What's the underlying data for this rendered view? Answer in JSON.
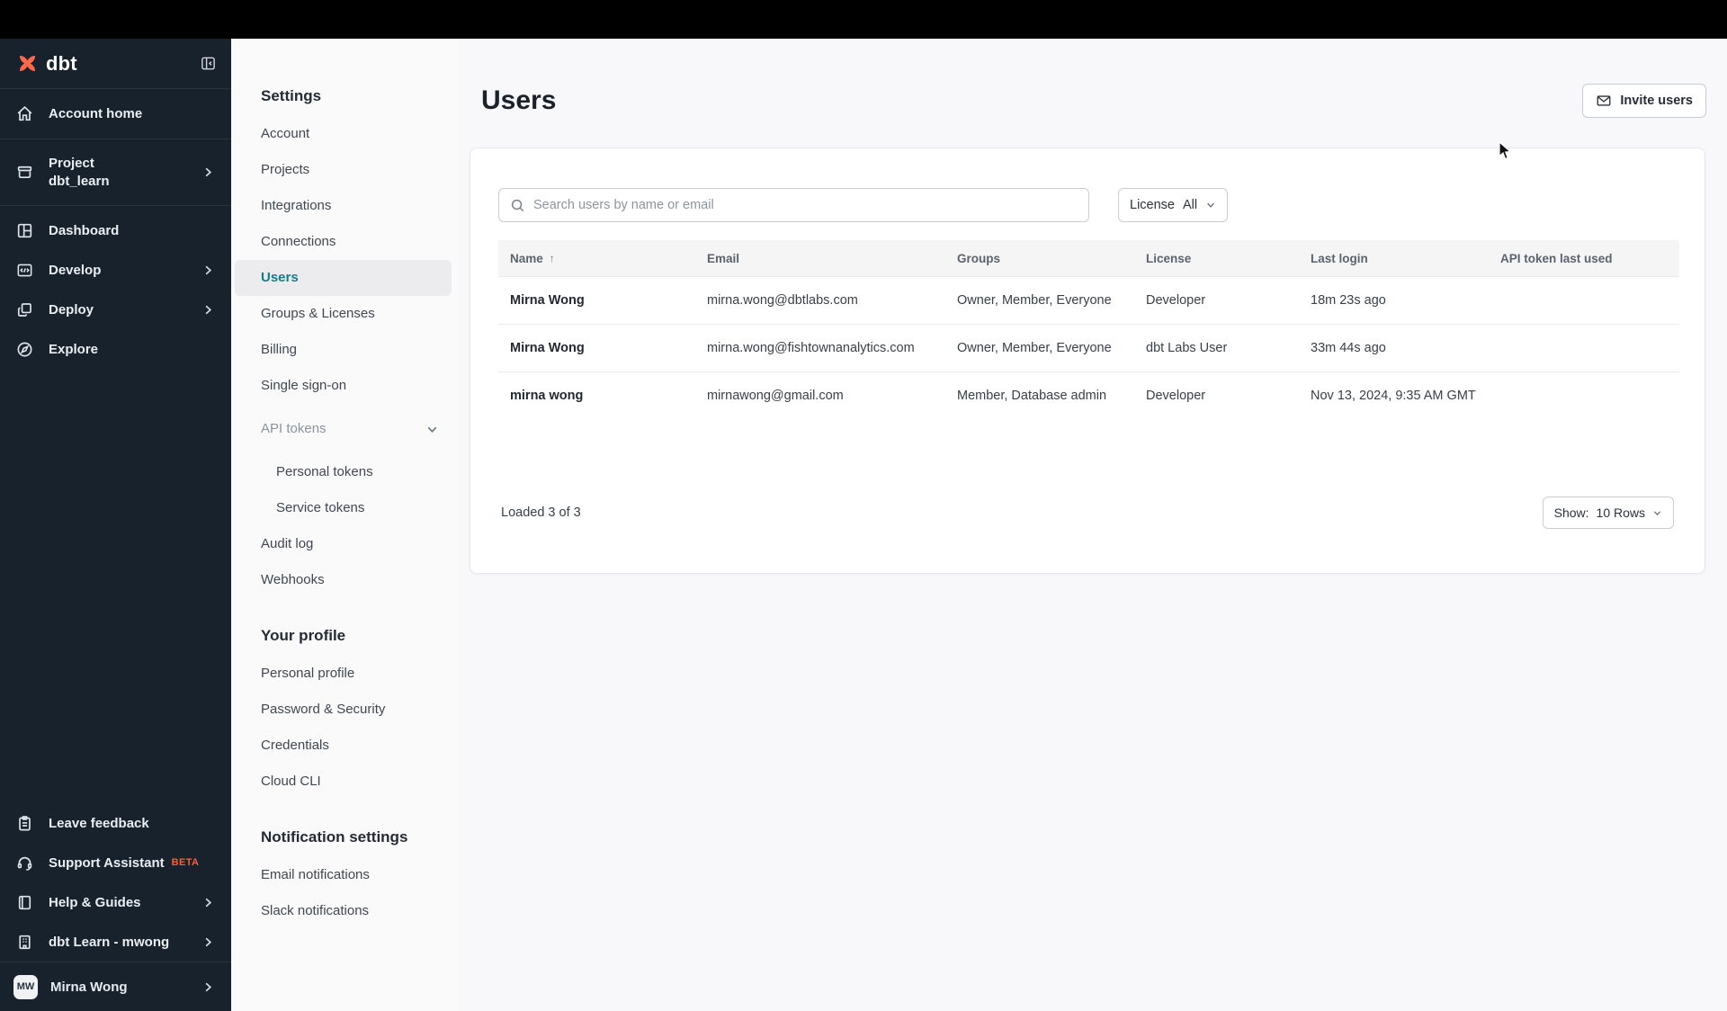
{
  "colors": {
    "brand_orange": "#FF694B",
    "active_teal": "#147D8C",
    "beta_badge": "#FF5C35",
    "sidebar_bg": "#18222D"
  },
  "sidebar": {
    "brand": "dbt",
    "account_home": {
      "icon": "home-icon",
      "label": "Account home"
    },
    "project": {
      "icon": "box-icon",
      "label": "Project",
      "name": "dbt_learn"
    },
    "menu": [
      {
        "icon": "grid-icon",
        "label": "Dashboard",
        "chevron": false
      },
      {
        "icon": "code-icon",
        "label": "Develop",
        "chevron": true
      },
      {
        "icon": "deploy-icon",
        "label": "Deploy",
        "chevron": true
      },
      {
        "icon": "compass-icon",
        "label": "Explore",
        "chevron": false
      }
    ],
    "bottom": [
      {
        "icon": "clipboard-icon",
        "label": "Leave feedback",
        "chevron": false
      },
      {
        "icon": "headset-icon",
        "label": "Support Assistant",
        "badge": "BETA",
        "chevron": false
      },
      {
        "icon": "book-icon",
        "label": "Help & Guides",
        "chevron": true
      },
      {
        "icon": "building-icon",
        "label": "dbt Learn - mwong",
        "chevron": true
      }
    ],
    "user": {
      "initials": "MW",
      "name": "Mirna Wong"
    }
  },
  "settings_nav": {
    "heading": "Settings",
    "items": [
      {
        "label": "Account"
      },
      {
        "label": "Projects"
      },
      {
        "label": "Integrations"
      },
      {
        "label": "Connections"
      },
      {
        "label": "Users",
        "active": true
      },
      {
        "label": "Groups & Licenses"
      },
      {
        "label": "Billing"
      },
      {
        "label": "Single sign-on"
      }
    ],
    "api_tokens": {
      "label": "API tokens",
      "children": [
        {
          "label": "Personal tokens"
        },
        {
          "label": "Service tokens"
        }
      ]
    },
    "items_after": [
      {
        "label": "Audit log"
      },
      {
        "label": "Webhooks"
      }
    ],
    "profile": {
      "heading": "Your profile",
      "items": [
        {
          "label": "Personal profile"
        },
        {
          "label": "Password & Security"
        },
        {
          "label": "Credentials"
        },
        {
          "label": "Cloud CLI"
        }
      ]
    },
    "notifications": {
      "heading": "Notification settings",
      "items": [
        {
          "label": "Email notifications"
        },
        {
          "label": "Slack notifications"
        }
      ]
    }
  },
  "main": {
    "title": "Users",
    "invite_button": "Invite users",
    "search_placeholder": "Search users by name or email",
    "license_filter": {
      "label": "License",
      "value": "All"
    },
    "table": {
      "columns": [
        "Name",
        "Email",
        "Groups",
        "License",
        "Last login",
        "API token last used"
      ],
      "sort": {
        "column": "Name",
        "direction": "asc",
        "glyph": "↑"
      },
      "rows": [
        {
          "name": "Mirna Wong",
          "email": "mirna.wong@dbtlabs.com",
          "groups": "Owner, Member, Everyone",
          "license": "Developer",
          "last_login": "18m 23s ago",
          "api_token_last_used": ""
        },
        {
          "name": "Mirna Wong",
          "email": "mirna.wong@fishtownanalytics.com",
          "groups": "Owner, Member, Everyone",
          "license": "dbt Labs User",
          "last_login": "33m 44s ago",
          "api_token_last_used": ""
        },
        {
          "name": "mirna wong",
          "email": "mirnawong@gmail.com",
          "groups": "Member, Database admin",
          "license": "Developer",
          "last_login": "Nov 13, 2024, 9:35 AM GMT",
          "api_token_last_used": ""
        }
      ]
    },
    "footer": {
      "loaded": "Loaded 3 of 3",
      "show_label": "Show:",
      "show_value": "10 Rows"
    }
  }
}
